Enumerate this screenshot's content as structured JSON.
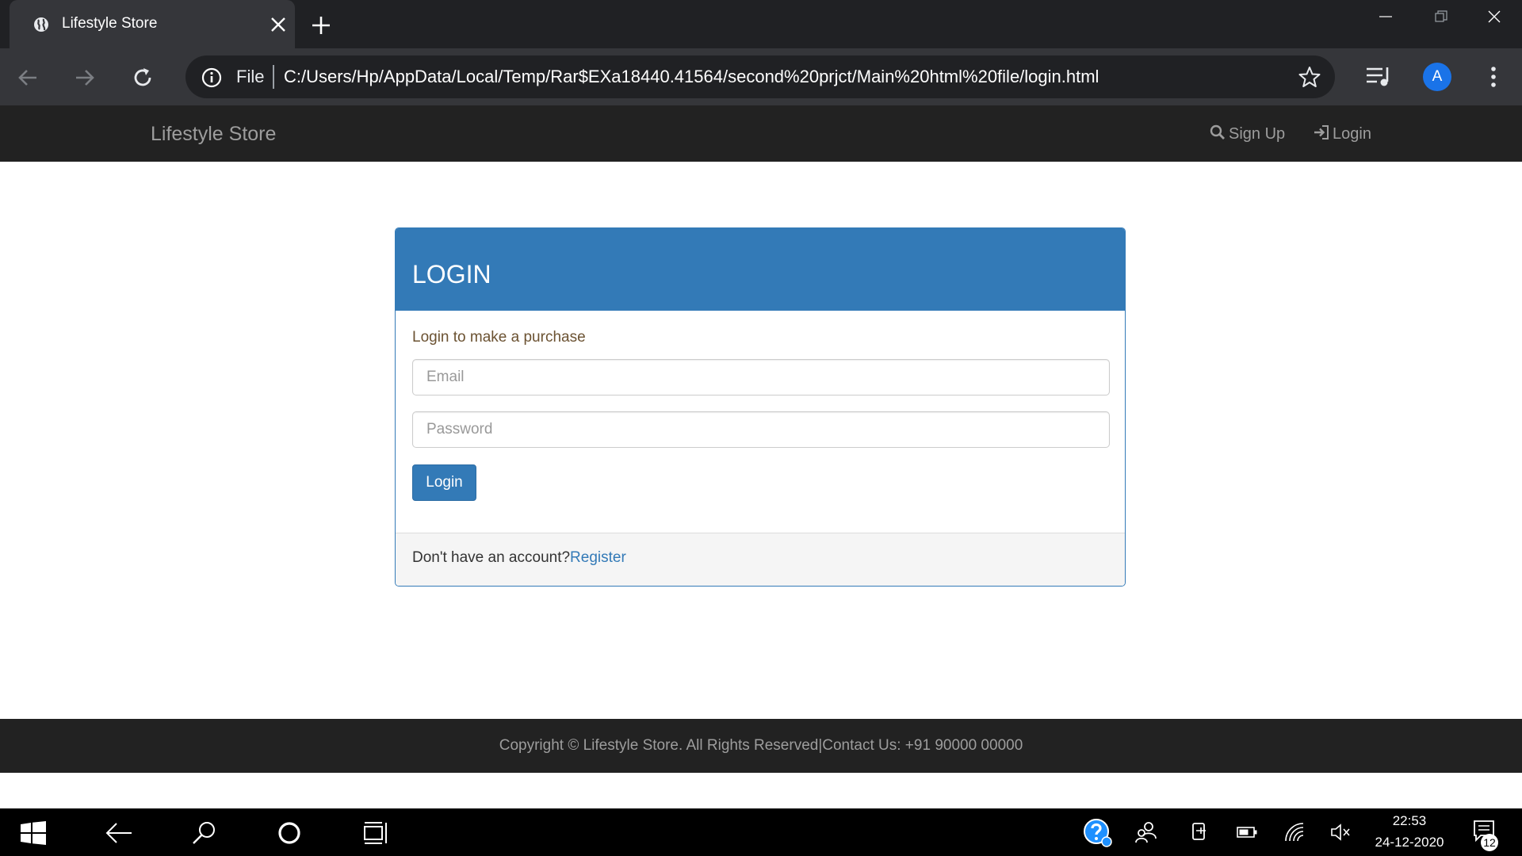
{
  "browser": {
    "tab": {
      "title": "Lifestyle Store",
      "favicon": "globe-icon",
      "close_icon": "close-icon"
    },
    "new_tab_icon": "plus-icon",
    "window_controls": [
      "minimize-icon",
      "restore-icon",
      "close-icon"
    ],
    "nav_icons": [
      "back-icon",
      "forward-icon",
      "reload-icon"
    ],
    "address_bar": {
      "scheme_chip": "File",
      "url": "C:/Users/Hp/AppData/Local/Temp/Rar$EXa18440.41564/second%20prjct/Main%20html%20file/login.html",
      "info_icon": "info-icon",
      "bookmark_icon": "star-icon"
    },
    "toolbar_icons": [
      "media-queue-icon",
      "menu-dots-icon"
    ],
    "profile_avatar": "A",
    "colors": {
      "tabbar": "#202124",
      "toolbar": "#35363a",
      "avatar": "#1a73e8"
    }
  },
  "site": {
    "navbar": {
      "brand": "Lifestyle Store",
      "links": [
        {
          "label": "Sign Up",
          "icon": "search-icon"
        },
        {
          "label": "Login",
          "icon": "log-in-icon"
        }
      ]
    },
    "login_panel": {
      "title": "LOGIN",
      "subtitle": "Login to make a purchase",
      "email_placeholder": "Email",
      "email_value": "",
      "password_placeholder": "Password",
      "password_value": "",
      "submit_label": "Login",
      "footer_text": "Don't have an account?",
      "register_link": "Register"
    },
    "footer": {
      "copyright": "Copyright © Lifestyle Store. All Rights Reserved|Contact Us: +91 90000 00000"
    },
    "colors": {
      "primary": "#337ab7",
      "navbar": "#222222",
      "nav_text": "#9d9d9d"
    }
  },
  "taskbar": {
    "icons": [
      "windows-start-icon",
      "back-arrow-icon",
      "search-icon",
      "cortana-icon",
      "task-view-icon"
    ],
    "tray_icons": [
      "help-icon",
      "people-icon",
      "device-icon",
      "battery-icon",
      "wifi-icon",
      "volume-muted-icon"
    ],
    "time": "22:53",
    "date": "24-12-2020",
    "notification_count": "12"
  }
}
